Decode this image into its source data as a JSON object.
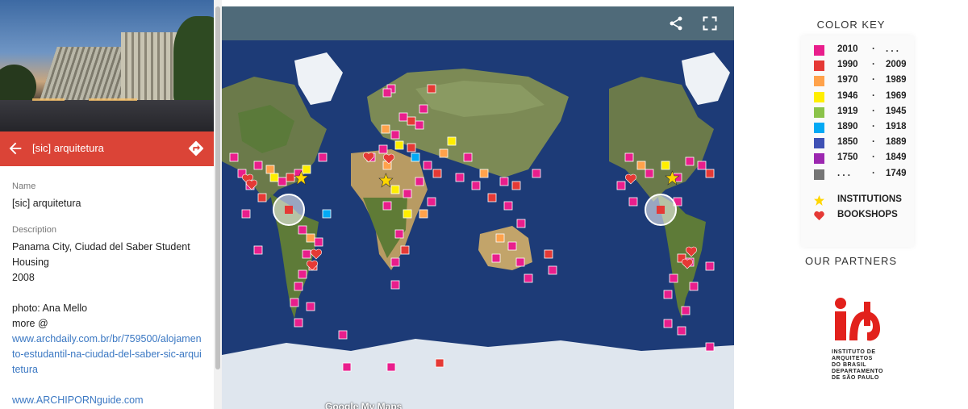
{
  "place": {
    "photo_alt": "",
    "title": "[sic] arquitetura",
    "fields": [
      {
        "label": "Name",
        "value": "[sic] arquitetura"
      },
      {
        "label": "Description",
        "value": "Panama City, Ciudad del Saber Student\nHousing\n2008"
      }
    ],
    "photo_credit": "photo: Ana Mello",
    "more_label": "more @",
    "link": "www.archdaily.com.br/br/759500/alojamento-estudantil-na-ciudad-del-saber-sic-arquitetura",
    "guide_link": "www.ARCHIPORNguide.com"
  },
  "map": {
    "attribution": "Google My Maps",
    "icons": [
      "share-icon",
      "fullscreen-icon"
    ]
  },
  "key": {
    "title": "COLOR KEY",
    "rows": [
      {
        "from": "2010",
        "to": ". . .",
        "color": "#e91e8c"
      },
      {
        "from": "1990",
        "to": "2009",
        "color": "#e53935"
      },
      {
        "from": "1970",
        "to": "1989",
        "color": "#ffa24b"
      },
      {
        "from": "1946",
        "to": "1969",
        "color": "#ffee00"
      },
      {
        "from": "1919",
        "to": "1945",
        "color": "#8bc34a"
      },
      {
        "from": "1890",
        "to": "1918",
        "color": "#03a9f4"
      },
      {
        "from": "1850",
        "to": "1889",
        "color": "#3f51b5"
      },
      {
        "from": "1750",
        "to": "1849",
        "color": "#9c27b0"
      },
      {
        "from": ". . .",
        "to": "1749",
        "color": "#757575"
      }
    ],
    "separator": "·",
    "institutions": "INSTITUTIONS",
    "bookshops": "BOOKSHOPS"
  },
  "partners": {
    "title": "OUR PARTNERS",
    "logo_text": "INSTITUTO DE ARQUITETOS DO BRASIL DEPARTAMENTO DE SÃO PAULO"
  },
  "colors": {
    "accent": "#db4437",
    "link": "#3b78c3",
    "map_header": "#4f6a79"
  }
}
